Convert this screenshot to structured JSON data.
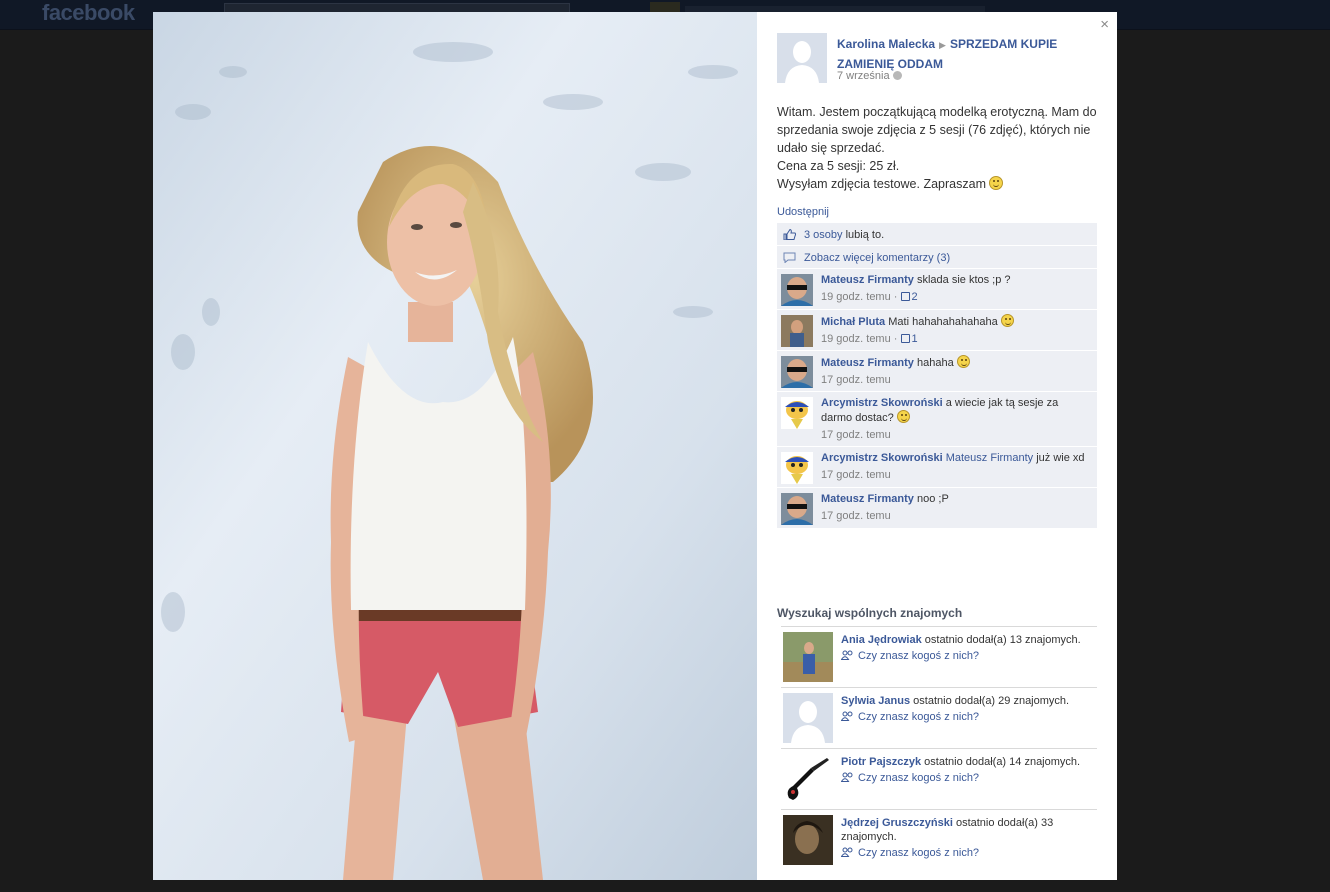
{
  "topbar": {
    "logo": "facebook"
  },
  "post": {
    "author": "Karolina Malecka",
    "group": "SPRZEDAM KUPIE ZAMIENIĘ ODDAM",
    "date": "7 września",
    "lines": [
      "Witam. Jestem początkującą modelką erotyczną. Mam do sprzedania swoje zdjęcia z 5 sesji (76 zdjęć), których nie udało się sprzedać.",
      "Cena za 5 sesji: 25 zł.",
      "Wysyłam zdjęcia testowe. Zapraszam"
    ],
    "share": "Udostępnij",
    "close": "×"
  },
  "likes": {
    "count_link": "3 osoby",
    "suffix": "lubią to."
  },
  "more_comments": "Zobacz więcej komentarzy (3)",
  "comments": [
    {
      "name": "Mateusz Firmanty",
      "text": "sklada sie ktos ;p ?",
      "time": "19 godz. temu",
      "likes": "2"
    },
    {
      "name": "Michał Pluta",
      "text": "Mati hahahahahahaha",
      "time": "19 godz. temu",
      "likes": "1"
    },
    {
      "name": "Mateusz Firmanty",
      "text": "hahaha",
      "time": "17 godz. temu"
    },
    {
      "name": "Arcymistrz Skowroński",
      "text": "a wiecie jak tą sesje za darmo dostac?",
      "time": "17 godz. temu"
    },
    {
      "name": "Arcymistrz Skowroński",
      "mention": "Mateusz Firmanty",
      "text": "już wie xd",
      "time": "17 godz. temu"
    },
    {
      "name": "Mateusz Firmanty",
      "text": "noo ;P",
      "time": "17 godz. temu"
    }
  ],
  "mutual": {
    "title": "Wyszukaj wspólnych znajomych",
    "ask": "Czy znasz kogoś z nich?",
    "items": [
      {
        "name": "Ania Jędrowiak",
        "text": "ostatnio dodał(a) 13 znajomych."
      },
      {
        "name": "Sylwia Janus",
        "text": "ostatnio dodał(a) 29 znajomych."
      },
      {
        "name": "Piotr Pajszczyk",
        "text": "ostatnio dodał(a) 14 znajomych."
      },
      {
        "name": "Jędrzej Gruszczyński",
        "text": "ostatnio dodał(a) 33 znajomych."
      }
    ]
  },
  "colors": {
    "link": "#3b5998",
    "ufi_bg": "#edeff4",
    "overlay": "#1b1b1b"
  }
}
